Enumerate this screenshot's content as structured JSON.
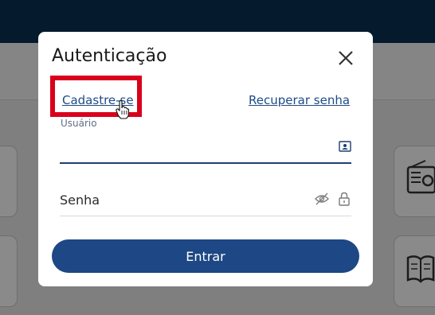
{
  "modal": {
    "title": "Autenticação",
    "register_link": "Cadastre-se",
    "recover_link": "Recuperar senha",
    "username_label": "Usuário",
    "username_value": "",
    "password_placeholder": "Senha",
    "submit_label": "Entrar"
  },
  "colors": {
    "primary": "#1d4785",
    "link": "#1e4b85",
    "highlight": "#d9001b",
    "topbar": "#061a2e"
  },
  "icons": [
    "close-icon",
    "id-card-icon",
    "eye-off-icon",
    "lock-icon",
    "radio-icon",
    "book-icon",
    "hand-pointer-cursor-icon"
  ]
}
